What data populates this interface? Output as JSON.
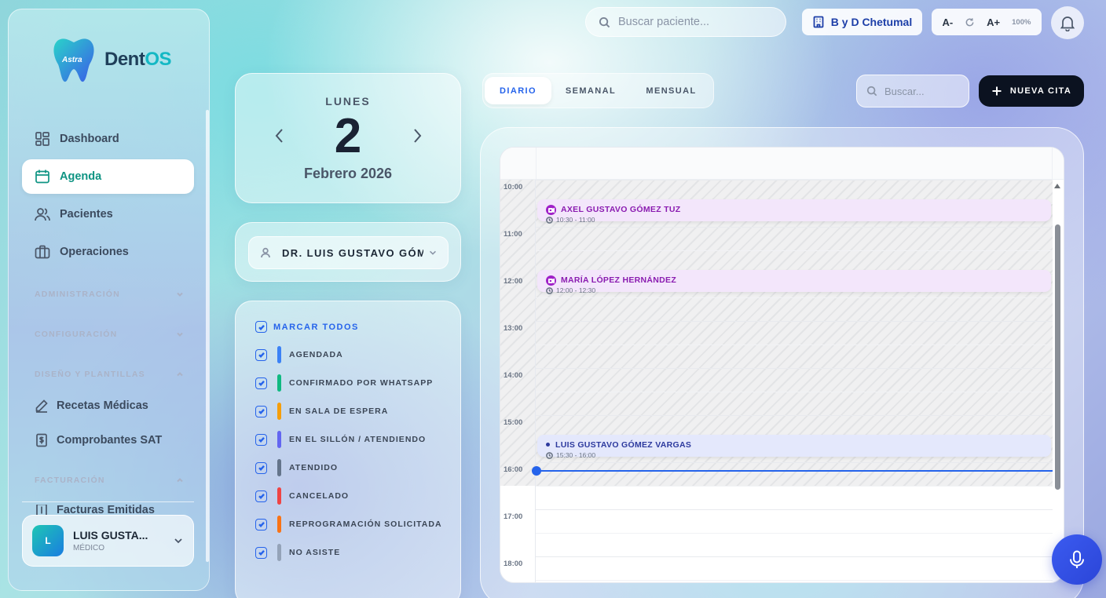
{
  "app": {
    "logo_badge": "Astra",
    "name_dent": "Dent",
    "name_os": "OS"
  },
  "sidebar": {
    "items": [
      {
        "label": "Dashboard",
        "icon": "grid-icon"
      },
      {
        "label": "Agenda",
        "icon": "calendar-icon",
        "active": true
      },
      {
        "label": "Pacientes",
        "icon": "users-icon"
      },
      {
        "label": "Operaciones",
        "icon": "briefcase-icon"
      }
    ],
    "sections": {
      "administracion": "ADMINISTRACIÓN",
      "configuracion": "CONFIGURACIÓN",
      "diseno": "DISEÑO Y PLANTILLAS",
      "facturacion": "FACTURACIÓN"
    },
    "sub_items": {
      "recetas": "Recetas Médicas",
      "comprobantes": "Comprobantes SAT",
      "facturas": "Facturas Emitidas"
    },
    "user": {
      "initial": "L",
      "name": "LUIS GUSTA...",
      "role": "MÉDICO"
    }
  },
  "topbar": {
    "search_placeholder": "Buscar paciente...",
    "clinic": "B y D Chetumal",
    "font_decrease": "A-",
    "font_increase": "A+",
    "zoom": "100%"
  },
  "date": {
    "weekday": "LUNES",
    "day": "2",
    "month_year": "Febrero 2026"
  },
  "doctor": {
    "selected": "DR. LUIS GUSTAVO GÓMEZ VARGAS"
  },
  "status_filter": {
    "mark_all": "MARCAR TODOS",
    "items": [
      {
        "label": "AGENDADA",
        "color": "#3b82f6"
      },
      {
        "label": "CONFIRMADO POR WHATSAPP",
        "color": "#10b981"
      },
      {
        "label": "EN SALA DE ESPERA",
        "color": "#f59e0b"
      },
      {
        "label": "EN EL SILLÓN / ATENDIENDO",
        "color": "#6366f1"
      },
      {
        "label": "ATENDIDO",
        "color": "#64748b"
      },
      {
        "label": "CANCELADO",
        "color": "#ef4444"
      },
      {
        "label": "REPROGRAMACIÓN SOLICITADA",
        "color": "#f97316"
      },
      {
        "label": "NO ASISTE",
        "color": "#94a3b8"
      }
    ]
  },
  "view_tabs": {
    "daily": "DIARIO",
    "weekly": "SEMANAL",
    "monthly": "MENSUAL",
    "active": "DIARIO"
  },
  "toolbar": {
    "search_placeholder": "Buscar...",
    "new_appointment": "NUEVA CITA"
  },
  "calendar": {
    "hours": [
      "10:00",
      "11:00",
      "12:00",
      "13:00",
      "14:00",
      "15:00",
      "16:00",
      "17:00",
      "18:00"
    ],
    "events": [
      {
        "patient": "AXEL GUSTAVO GÓMEZ TUZ",
        "time": "10:30 - 11:00",
        "type": "video",
        "color": "#f3e6fb",
        "text_color": "#8a1bb0"
      },
      {
        "patient": "MARÍA LÓPEZ HERNÁNDEZ",
        "time": "12:00 - 12:30",
        "type": "video",
        "color": "#f3e6fb",
        "text_color": "#8a1bb0"
      },
      {
        "patient": "LUIS GUSTAVO GÓMEZ VARGAS",
        "time": "15:30 - 16:00",
        "type": "dot",
        "color": "#e4e8fc",
        "text_color": "#2d3a9e"
      }
    ]
  }
}
